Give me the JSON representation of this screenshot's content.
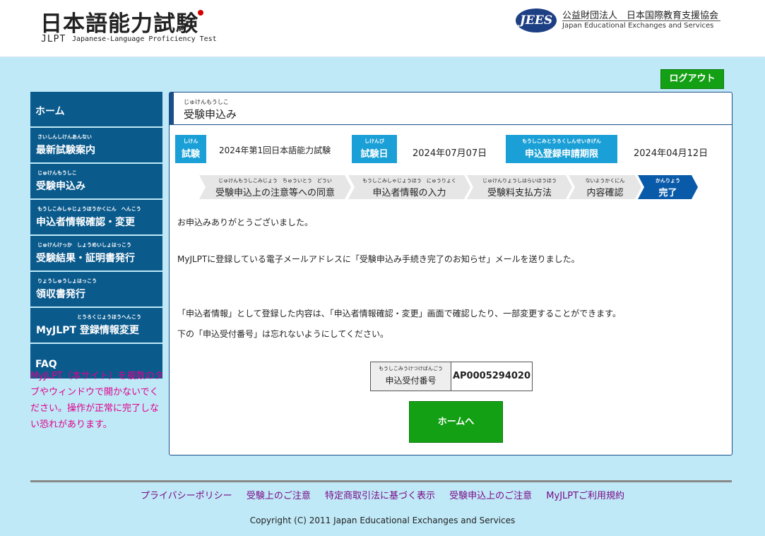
{
  "header": {
    "logo_jp": "日本語能力試験",
    "logo_jlpt": "JLPT",
    "logo_en": "Japanese-Language Proficiency Test",
    "org_badge": "JEES",
    "org_jp": "公益財団法人　日本国際教育支援協会",
    "org_en": "Japan Educational Exchanges and Services"
  },
  "logout": "ログアウト",
  "sidebar": {
    "items": [
      {
        "ruby": "",
        "label": "ホーム"
      },
      {
        "ruby": "さいしんしけんあんない",
        "label": "最新試験案内"
      },
      {
        "ruby": "じゅけんもうしこ",
        "label": "受験申込み"
      },
      {
        "ruby": "もうしこみしゃじょうほうかくにん　へんこう",
        "label": "申込者情報確認・変更"
      },
      {
        "ruby": "じゅけんけっか　しょうめいしょはっこう",
        "label": "受験結果・証明書発行"
      },
      {
        "ruby": "りょうしゅうしょはっこう",
        "label": "領収書発行"
      },
      {
        "ruby": "とうろくじょうほうへんこう",
        "label": "MyJLPT 登録情報変更"
      },
      {
        "ruby": "",
        "label": "FAQ"
      }
    ],
    "note": "MyJLPT（本サイト）を複数のタブやウィンドウで開かないでください。操作が正常に完了しない恐れがあります。"
  },
  "panel": {
    "title_ruby": "じゅけんもうしこ",
    "title": "受験申込み",
    "info": {
      "exam_label_ruby": "しけん",
      "exam_label": "試験",
      "exam_value": "2024年第1回日本語能力試験",
      "date_label_ruby": "しけんび",
      "date_label": "試験日",
      "date_value": "2024年07月07日",
      "deadline_label_ruby": "もうしこみとうろくしんせいきげん",
      "deadline_label": "申込登録申請期限",
      "deadline_value": "2024年04月12日"
    },
    "steps": [
      {
        "ruby": "じゅけんもうしこみじょう　ちゅういとう　どうい",
        "label": "受験申込上の注意等への同意"
      },
      {
        "ruby": "もうしこみしゃじょうほう　にゅうりょく",
        "label": "申込者情報の入力"
      },
      {
        "ruby": "じゅけんりょうしはらいほうほう",
        "label": "受験料支払方法"
      },
      {
        "ruby": "ないようかくにん",
        "label": "内容確認"
      },
      {
        "ruby": "かんりょう",
        "label": "完了"
      }
    ],
    "messages": [
      "お申込みありがとうございました。",
      "MyJLPTに登録している電子メールアドレスに「受験申込み手続き完了のお知らせ」メールを送りました。",
      "「申込者情報」として登録した内容は、「申込者情報確認・変更」画面で確認したり、一部変更することができます。",
      "下の「申込受付番号」は忘れないようにしてください。"
    ],
    "acceptance_label_ruby": "もうしこみうけつけばんごう",
    "acceptance_label": "申込受付番号",
    "acceptance_number": "AP0005294020",
    "home_button": "ホームへ"
  },
  "footer": {
    "links": [
      "プライバシーポリシー",
      "受験上のご注意",
      "特定商取引法に基づく表示",
      "受験申込上のご注意",
      "MyJLPTご利用規約"
    ],
    "copyright": "Copyright (C) 2011  Japan Educational Exchanges and Services"
  }
}
